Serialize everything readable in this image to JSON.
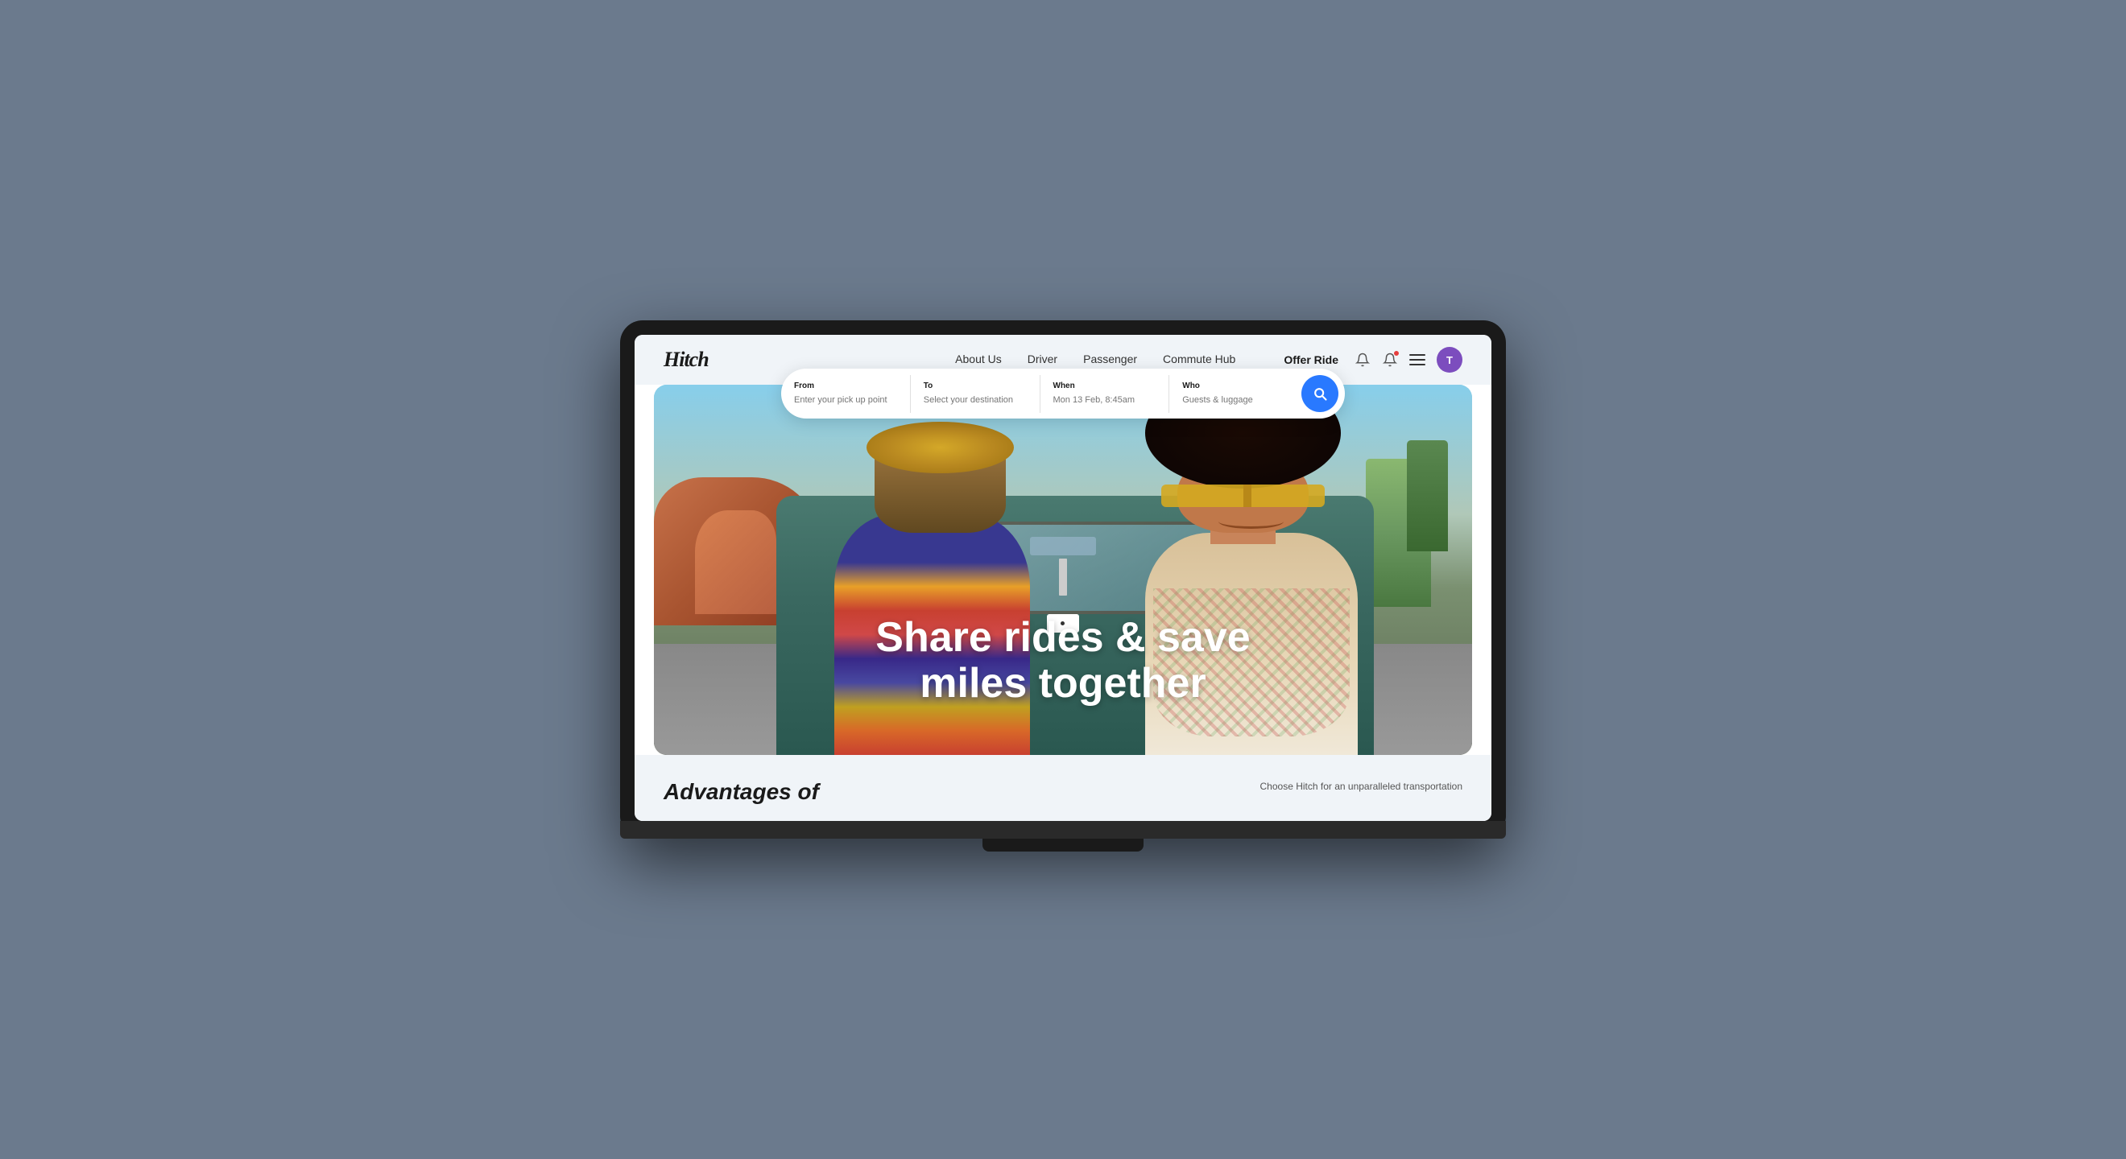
{
  "brand": {
    "name": "Hitch"
  },
  "navbar": {
    "links": [
      {
        "label": "About Us",
        "href": "#"
      },
      {
        "label": "Driver",
        "href": "#"
      },
      {
        "label": "Passenger",
        "href": "#"
      },
      {
        "label": "Commute Hub",
        "href": "#"
      }
    ],
    "offer_ride_label": "Offer Ride",
    "avatar_initial": "T"
  },
  "search": {
    "from_label": "From",
    "from_placeholder": "Enter your pick up point",
    "to_label": "To",
    "to_placeholder": "Select your destination",
    "when_label": "When",
    "when_value": "Mon 13 Feb, 8:45am",
    "who_label": "Who",
    "who_placeholder": "Guests & luggage",
    "button_label": "Search"
  },
  "hero": {
    "headline_line1": "Share rides & save",
    "headline_line2": "miles together"
  },
  "bottom": {
    "advantages_title": "Advantages of",
    "advantages_desc": "Choose Hitch for an unparalleled transportation"
  }
}
